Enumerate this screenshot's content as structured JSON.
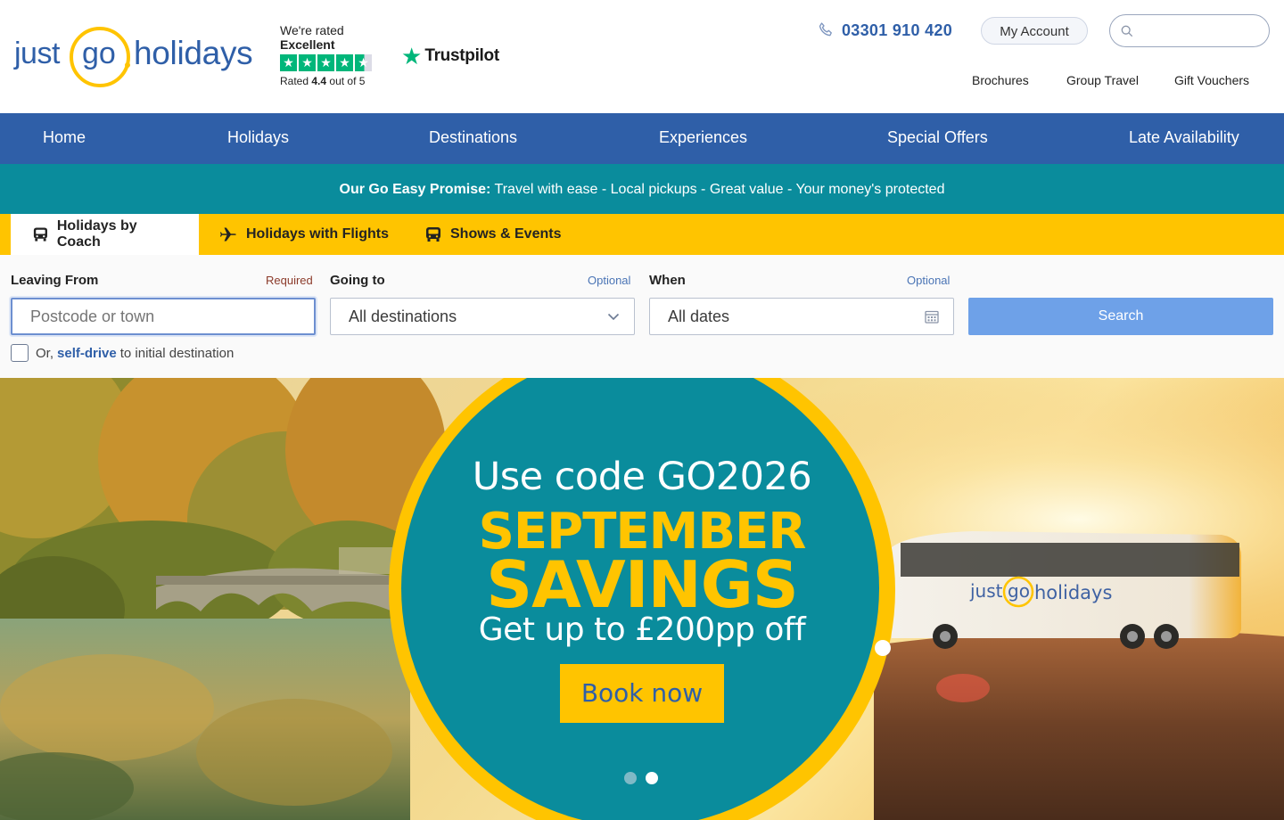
{
  "brand": {
    "just": "just",
    "go": "go",
    "holidays": "holidays"
  },
  "rating": {
    "rated_line": "We're rated",
    "excellent": "Excellent",
    "rated_prefix": "Rated",
    "score": "4.4",
    "out_of": "out of 5",
    "stars_value": 4.4,
    "trustpilot": "Trustpilot"
  },
  "header": {
    "phone": "03301 910 420",
    "my_account": "My Account",
    "search_placeholder": "",
    "links": [
      "Brochures",
      "Group Travel",
      "Gift Vouchers"
    ]
  },
  "nav": [
    "Home",
    "Holidays",
    "Destinations",
    "Experiences",
    "Special Offers",
    "Late Availability"
  ],
  "promise": {
    "title": "Our Go Easy Promise:",
    "text": "Travel with ease - Local pickups - Great value - Your money's protected"
  },
  "tabs": [
    {
      "label": "Holidays by Coach",
      "icon": "coach-icon",
      "active": true
    },
    {
      "label": "Holidays with Flights",
      "icon": "plane-icon",
      "active": false
    },
    {
      "label": "Shows & Events",
      "icon": "coach-icon",
      "active": false
    }
  ],
  "search": {
    "leaving_label": "Leaving From",
    "leaving_note": "Required",
    "leaving_placeholder": "Postcode or town",
    "going_label": "Going to",
    "going_note": "Optional",
    "going_value": "All destinations",
    "when_label": "When",
    "when_note": "Optional",
    "when_value": "All dates",
    "button": "Search",
    "selfdrive_prefix": "Or,",
    "selfdrive_link": "self-drive",
    "selfdrive_suffix": "to initial destination",
    "selfdrive_checked": false
  },
  "hero": {
    "code_line": "Use code GO2026",
    "line1": "SEPTEMBER",
    "line2": "SAVINGS",
    "offer": "Get up to £200pp off",
    "button": "Book now",
    "bus_branding": "just go. holidays",
    "slides": 2,
    "active_slide": 2
  },
  "colors": {
    "brand_blue": "#2f5fa8",
    "brand_yellow": "#ffc400",
    "teal": "#0a8c9c",
    "trustpilot_green": "#00b67a",
    "search_button": "#6ea1e8"
  }
}
